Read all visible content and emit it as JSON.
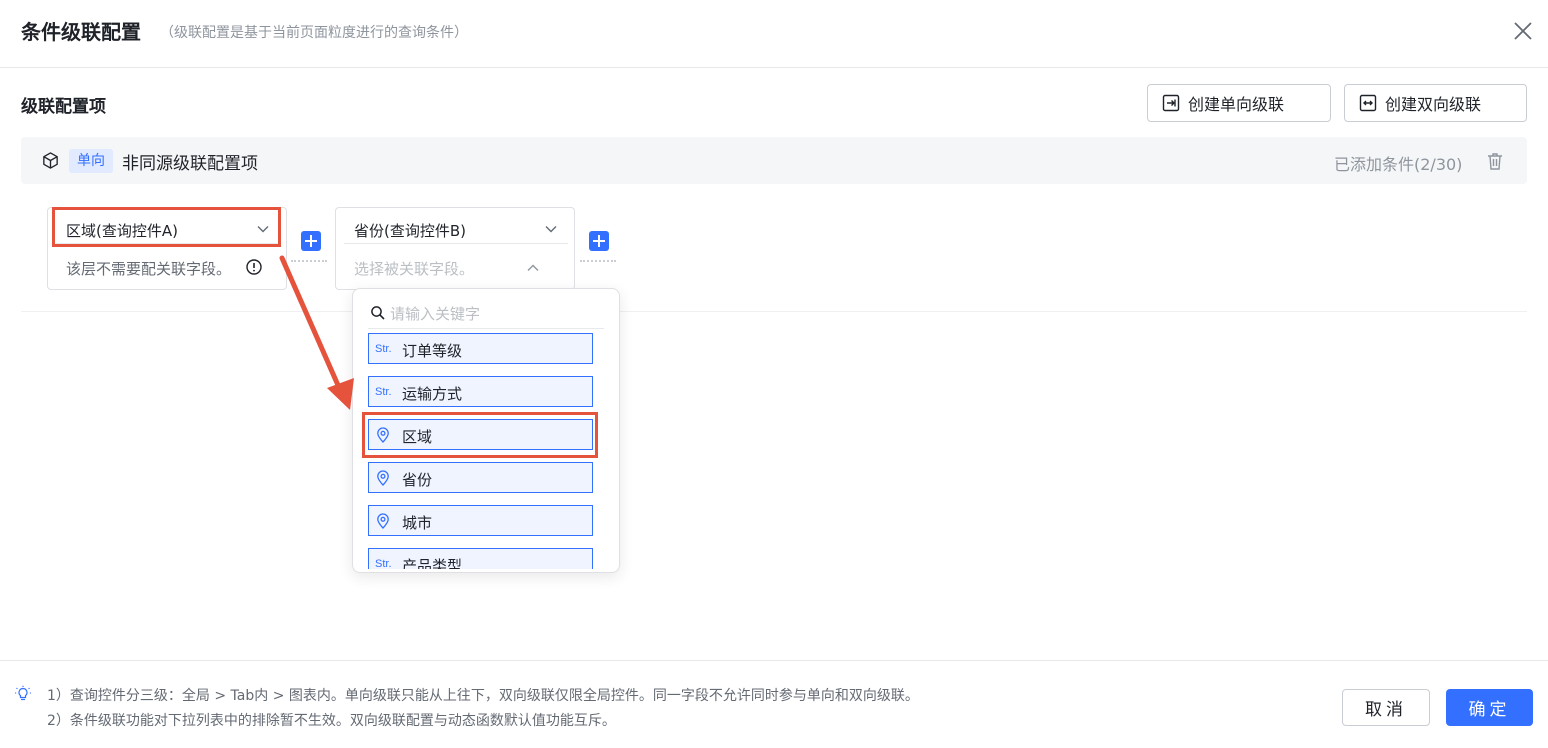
{
  "modal": {
    "title": "条件级联配置",
    "subtitle": "（级联配置是基于当前页面粒度进行的查询条件）"
  },
  "section": {
    "title": "级联配置项",
    "create_one_way": "创建单向级联",
    "create_two_way": "创建双向级联"
  },
  "config_item": {
    "direction_tag": "单向",
    "name": "非同源级联配置项",
    "added_count": "已添加条件(2/30)",
    "icons": [
      "cube-icon",
      "trash-icon"
    ]
  },
  "cards": [
    {
      "select_value": "区域(查询控件A)",
      "sub_text": "该层不需要配关联字段。",
      "icon": "info-icon"
    },
    {
      "select_value": "省份(查询控件B)",
      "sub_text": "选择被关联字段。",
      "icon": "chevron-up-icon"
    }
  ],
  "dropdown": {
    "search_placeholder": "请输入关键字",
    "type_label": "Str.",
    "items": [
      {
        "name": "订单等级",
        "type": "str"
      },
      {
        "name": "运输方式",
        "type": "str"
      },
      {
        "name": "区域",
        "type": "geo",
        "highlighted": true
      },
      {
        "name": "省份",
        "type": "geo"
      },
      {
        "name": "城市",
        "type": "geo"
      },
      {
        "name": "产品类型",
        "type": "str"
      }
    ]
  },
  "footer": {
    "note_1": "1）查询控件分三级：全局 > Tab内 > 图表内。单向级联只能从上往下，双向级联仅限全局控件。同一字段不允许同时参与单向和双向级联。",
    "note_2": "2）条件级联功能对下拉列表中的排除暂不生效。双向级联配置与动态函数默认值功能互斥。",
    "cancel": "取消",
    "ok": "确定"
  },
  "colors": {
    "primary": "#3370ff",
    "annotation_red": "#e5533d",
    "tag_bg": "#e1eaff"
  }
}
